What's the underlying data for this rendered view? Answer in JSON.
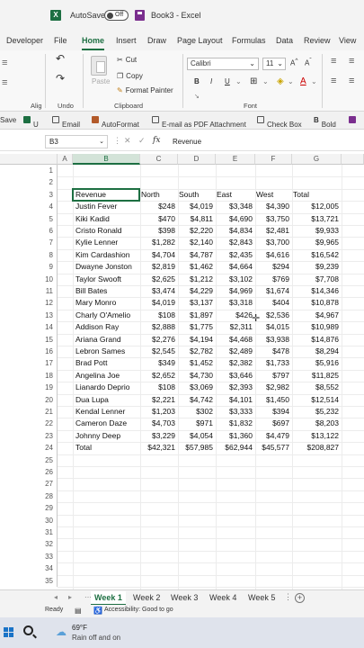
{
  "titlebar": {
    "app_letter": "X",
    "autosave_label": "AutoSave",
    "autosave_state": "Off",
    "doc_title": "Book3  -  Excel"
  },
  "tabs": [
    "Developer",
    "File",
    "Home",
    "Insert",
    "Draw",
    "Page Layout",
    "Formulas",
    "Data",
    "Review",
    "View"
  ],
  "ribbon": {
    "cut": "Cut",
    "copy": "Copy",
    "format_painter": "Format Painter",
    "paste": "Paste",
    "font_name": "Calibri",
    "font_size": "11",
    "bold": "B",
    "italic": "I",
    "underline": "U",
    "group_undo": "Undo",
    "group_clipboard": "Clipboard",
    "group_font": "Font",
    "group_align": "Alig"
  },
  "qat": {
    "save": "Save",
    "u": "U",
    "email": "Email",
    "autoformat": "AutoFormat",
    "email_pdf": "E-mail as PDF Attachment",
    "check_box": "Check Box",
    "bold": "Bold"
  },
  "formula": {
    "name_box": "B3",
    "fx": "fx",
    "value": "Revenue"
  },
  "columns": [
    "A",
    "B",
    "C",
    "D",
    "E",
    "F",
    "G"
  ],
  "rows": [
    "1",
    "2",
    "3",
    "4",
    "5",
    "6",
    "7",
    "8",
    "9",
    "10",
    "11",
    "12",
    "13",
    "14",
    "15",
    "16",
    "17",
    "18",
    "19",
    "20",
    "21",
    "22",
    "23",
    "24",
    "25",
    "26",
    "27",
    "28",
    "29",
    "30",
    "31",
    "32",
    "33",
    "34",
    "35"
  ],
  "table": {
    "headers": [
      "Revenue",
      "North",
      "South",
      "East",
      "West",
      "Total"
    ],
    "rows": [
      [
        "Justin Fever",
        "$248",
        "$4,019",
        "$3,348",
        "$4,390",
        "$12,005"
      ],
      [
        "Kiki Kadid",
        "$470",
        "$4,811",
        "$4,690",
        "$3,750",
        "$13,721"
      ],
      [
        "Cristo Ronald",
        "$398",
        "$2,220",
        "$4,834",
        "$2,481",
        "$9,933"
      ],
      [
        "Kylie Lenner",
        "$1,282",
        "$2,140",
        "$2,843",
        "$3,700",
        "$9,965"
      ],
      [
        "Kim Cardashion",
        "$4,704",
        "$4,787",
        "$2,435",
        "$4,616",
        "$16,542"
      ],
      [
        "Dwayne Jonston",
        "$2,819",
        "$1,462",
        "$4,664",
        "$294",
        "$9,239"
      ],
      [
        "Taylor Swooft",
        "$2,625",
        "$1,212",
        "$3,102",
        "$769",
        "$7,708"
      ],
      [
        "Bill Bates",
        "$3,474",
        "$4,229",
        "$4,969",
        "$1,674",
        "$14,346"
      ],
      [
        "Mary Monro",
        "$4,019",
        "$3,137",
        "$3,318",
        "$404",
        "$10,878"
      ],
      [
        "Charly O'Amelio",
        "$108",
        "$1,897",
        "$426",
        "$2,536",
        "$4,967"
      ],
      [
        "Addison Ray",
        "$2,888",
        "$1,775",
        "$2,311",
        "$4,015",
        "$10,989"
      ],
      [
        "Ariana Grand",
        "$2,276",
        "$4,194",
        "$4,468",
        "$3,938",
        "$14,876"
      ],
      [
        "Lebron Sames",
        "$2,545",
        "$2,782",
        "$2,489",
        "$478",
        "$8,294"
      ],
      [
        "Brad Pott",
        "$349",
        "$1,452",
        "$2,382",
        "$1,733",
        "$5,916"
      ],
      [
        "Angelina Joe",
        "$2,652",
        "$4,730",
        "$3,646",
        "$797",
        "$11,825"
      ],
      [
        "Lianardo Deprio",
        "$108",
        "$3,069",
        "$2,393",
        "$2,982",
        "$8,552"
      ],
      [
        "Dua Lupa",
        "$2,221",
        "$4,742",
        "$4,101",
        "$1,450",
        "$12,514"
      ],
      [
        "Kendal Lenner",
        "$1,203",
        "$302",
        "$3,333",
        "$394",
        "$5,232"
      ],
      [
        "Cameron Daze",
        "$4,703",
        "$971",
        "$1,832",
        "$697",
        "$8,203"
      ],
      [
        "Johnny Deep",
        "$3,229",
        "$4,054",
        "$1,360",
        "$4,479",
        "$13,122"
      ],
      [
        "Total",
        "$42,321",
        "$57,985",
        "$62,944",
        "$45,577",
        "$208,827"
      ]
    ]
  },
  "sheets": [
    "Week 1",
    "Week 2",
    "Week 3",
    "Week 4",
    "Week 5"
  ],
  "status": {
    "ready": "Ready",
    "accessibility": "Accessibility: Good to go"
  },
  "taskbar": {
    "temperature": "69°F",
    "condition": "Rain off and on"
  }
}
